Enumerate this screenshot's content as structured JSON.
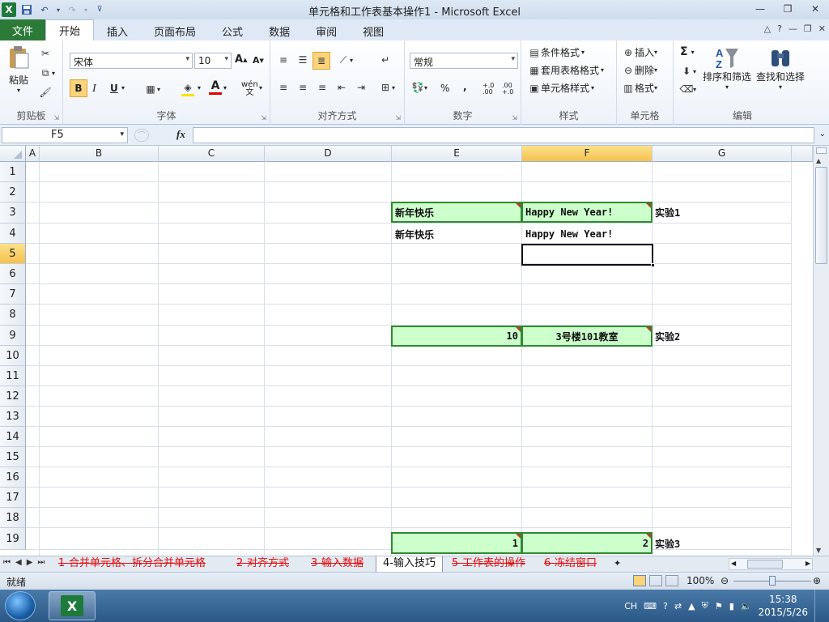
{
  "window": {
    "title": "单元格和工作表基本操作1 - Microsoft Excel"
  },
  "qat": {
    "save": "save-icon",
    "undo": "undo-icon",
    "redo": "redo-icon"
  },
  "tabs": [
    {
      "label": "文件"
    },
    {
      "label": "开始"
    },
    {
      "label": "插入"
    },
    {
      "label": "页面布局"
    },
    {
      "label": "公式"
    },
    {
      "label": "数据"
    },
    {
      "label": "审阅"
    },
    {
      "label": "视图"
    }
  ],
  "ribbon": {
    "clipboard": {
      "group": "剪贴板",
      "paste": "粘贴"
    },
    "font": {
      "group": "字体",
      "name": "宋体",
      "size": "10",
      "bold": "B",
      "italic": "I",
      "underline": "U",
      "wen": "wén",
      "fontcolor": "A"
    },
    "align": {
      "group": "对齐方式"
    },
    "number": {
      "group": "数字",
      "format": "常规",
      "percent": "%",
      "comma": ",",
      "inc": "+.0 .00",
      "dec": ".00 +.0"
    },
    "styles": {
      "group": "样式",
      "cond": "条件格式",
      "table": "套用表格格式",
      "cell": "单元格样式"
    },
    "cells": {
      "group": "单元格",
      "insert": "插入",
      "delete": "删除",
      "format": "格式"
    },
    "editing": {
      "group": "编辑",
      "sum": "Σ",
      "sort": "排序和筛选",
      "find": "查找和选择"
    }
  },
  "formula": {
    "namebox": "F5",
    "fx": "fx",
    "value": ""
  },
  "columns": [
    "A",
    "B",
    "C",
    "D",
    "E",
    "F",
    "G"
  ],
  "rows": [
    "1",
    "2",
    "3",
    "4",
    "5",
    "6",
    "7",
    "8",
    "9",
    "10",
    "11",
    "12",
    "13",
    "14",
    "15",
    "16",
    "17",
    "18",
    "19"
  ],
  "cells": {
    "E3": "新年快乐",
    "F3": "Happy New Year!",
    "G3": "实验1",
    "E4": "新年快乐",
    "F4": "Happy New Year!",
    "E9": "10",
    "F9": "3号楼101教室",
    "G9": "实验2",
    "E19": "1",
    "F19": "2",
    "G19": "实验3"
  },
  "sheets": [
    {
      "label": "1-合并单元格、拆分合并单元格"
    },
    {
      "label": "2-对齐方式"
    },
    {
      "label": "3-输入数据"
    },
    {
      "label": "4-输入技巧"
    },
    {
      "label": "5-工作表的操作"
    },
    {
      "label": "6-冻结窗口"
    }
  ],
  "status": {
    "ready": "就绪",
    "zoom": "100%"
  },
  "taskbar": {
    "lang": "CH",
    "time": "15:38",
    "date": "2015/5/26"
  },
  "colors": {
    "accent_green": "#2b7a38",
    "cell_fill": "#ccffcc",
    "cell_border": "#2f8a2f",
    "sheet_tab_text": "#e01010"
  }
}
